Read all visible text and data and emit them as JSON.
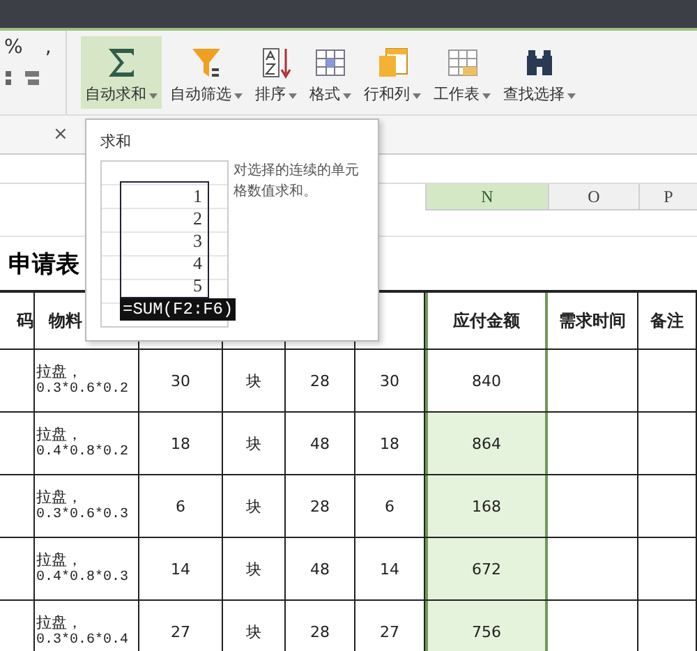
{
  "ribbon": {
    "left_buttons": [
      "%",
      ","
    ],
    "buttons": [
      {
        "label": "自动求和",
        "selected": true
      },
      {
        "label": "自动筛选",
        "selected": false
      },
      {
        "label": "排序",
        "selected": false
      },
      {
        "label": "格式",
        "selected": false
      },
      {
        "label": "行和列",
        "selected": false
      },
      {
        "label": "工作表",
        "selected": false
      },
      {
        "label": "查找选择",
        "selected": false
      }
    ]
  },
  "tab_close": "×",
  "popup": {
    "title": "求和",
    "example_values": [
      "1",
      "2",
      "3",
      "4",
      "5"
    ],
    "example_formula": "=SUM(F2:F6)",
    "description": "对选择的连续的单元格数值求和。"
  },
  "columns": [
    {
      "label": "N",
      "selected": true
    },
    {
      "label": "O",
      "selected": false
    },
    {
      "label": "P",
      "selected": false
    }
  ],
  "sheet_title": "申请表",
  "table": {
    "headers": [
      "码",
      "物料",
      "应付金额",
      "需求时间",
      "备注"
    ],
    "rows": [
      {
        "name": "拉盘，",
        "spec": "0.3*0.6*0.2",
        "qty": "30",
        "unit": "块",
        "price": "28",
        "count": "30",
        "amount": "840",
        "active": true
      },
      {
        "name": "拉盘，",
        "spec": "0.4*0.8*0.2",
        "qty": "18",
        "unit": "块",
        "price": "48",
        "count": "18",
        "amount": "864",
        "active": false
      },
      {
        "name": "拉盘，",
        "spec": "0.3*0.6*0.3",
        "qty": "6",
        "unit": "块",
        "price": "28",
        "count": "6",
        "amount": "168",
        "active": false
      },
      {
        "name": "拉盘，",
        "spec": "0.4*0.8*0.3",
        "qty": "14",
        "unit": "块",
        "price": "48",
        "count": "14",
        "amount": "672",
        "active": false
      },
      {
        "name": "拉盘，",
        "spec": "0.3*0.6*0.4",
        "qty": "27",
        "unit": "块",
        "price": "28",
        "count": "27",
        "amount": "756",
        "active": false
      }
    ]
  }
}
